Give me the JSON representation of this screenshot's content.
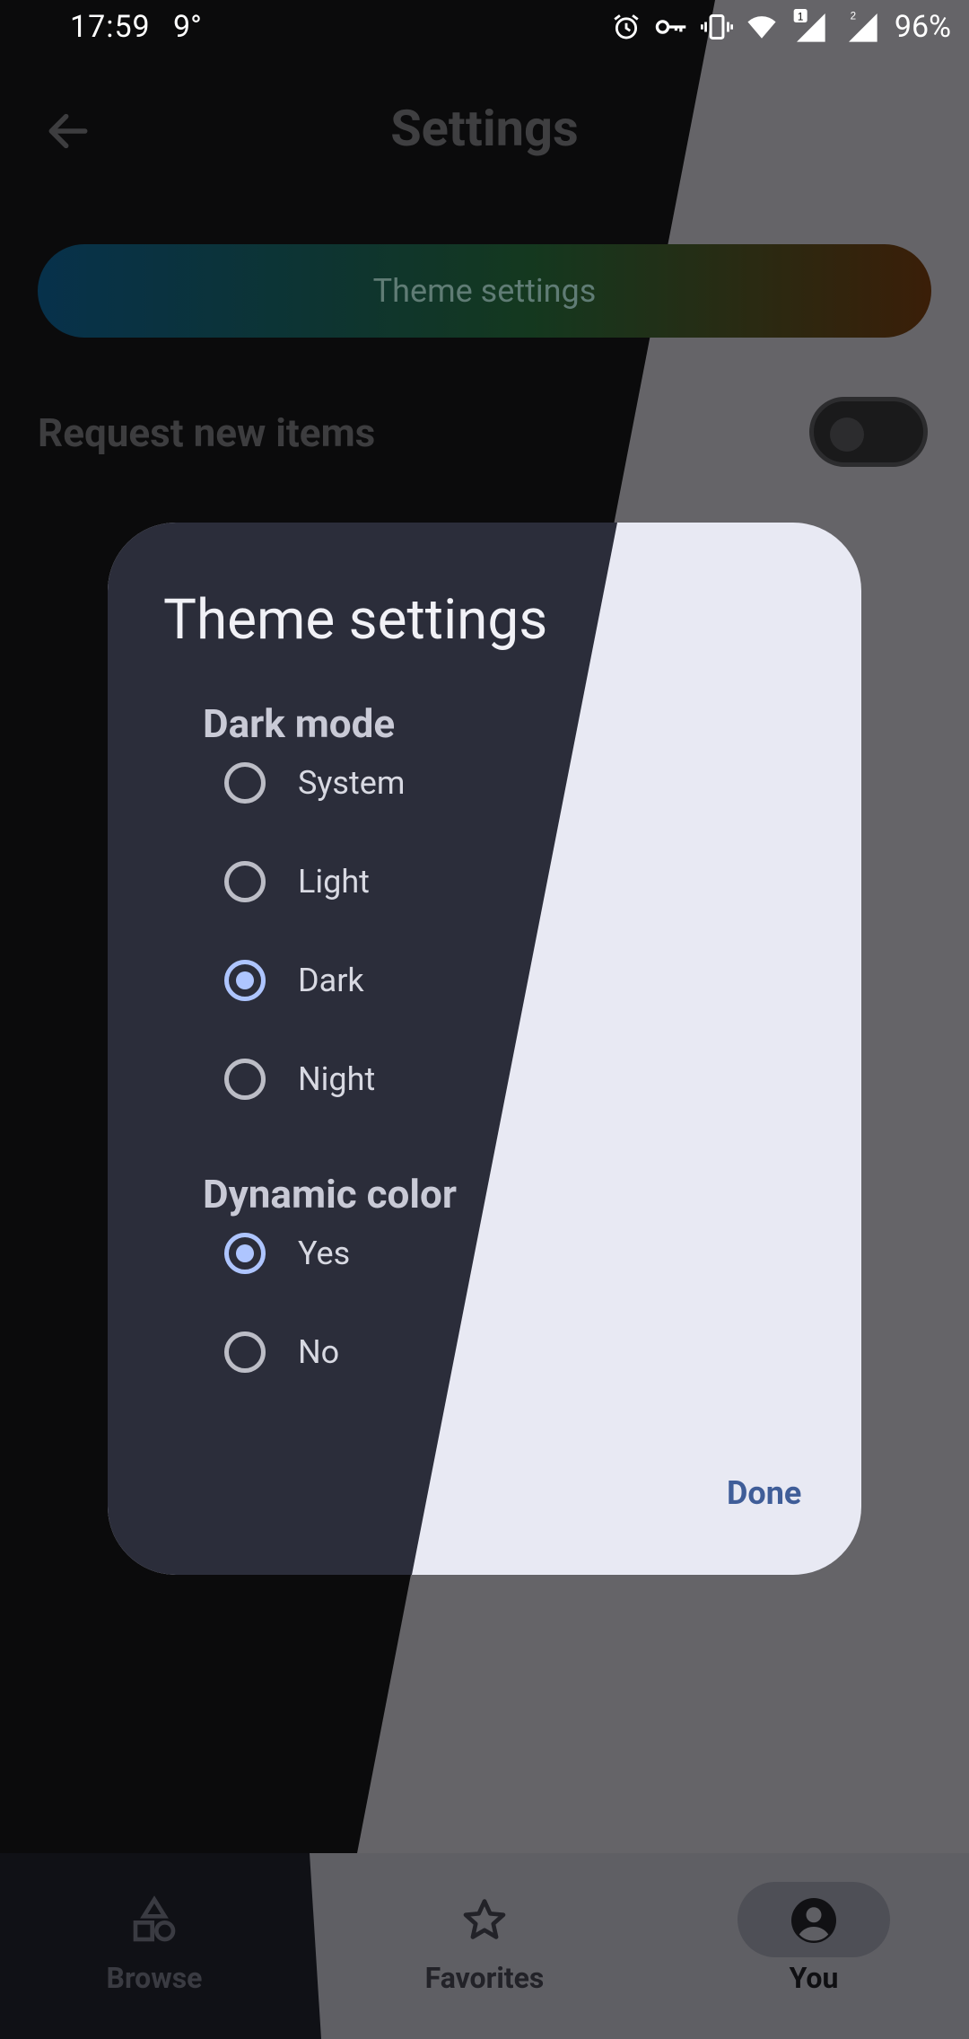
{
  "status_bar": {
    "time": "17:59",
    "temperature": "9°",
    "battery": "96%"
  },
  "app_bar": {
    "title": "Settings",
    "back_icon": "arrow-back-icon"
  },
  "theme_button": {
    "label": "Theme settings"
  },
  "request_new_items": {
    "label": "Request new items",
    "enabled": false
  },
  "dialog": {
    "title": "Theme settings",
    "dark_mode": {
      "heading": "Dark mode",
      "options": [
        {
          "label": "System",
          "selected": false
        },
        {
          "label": "Light",
          "selected": false
        },
        {
          "label": "Dark",
          "selected": true
        },
        {
          "label": "Night",
          "selected": false
        }
      ]
    },
    "dynamic_color": {
      "heading": "Dynamic color",
      "options": [
        {
          "label": "Yes",
          "selected": true
        },
        {
          "label": "No",
          "selected": false
        }
      ]
    },
    "done_label": "Done"
  },
  "bottom_nav": {
    "items": [
      {
        "label": "Browse",
        "icon": "shapes-icon",
        "active": false
      },
      {
        "label": "Favorites",
        "icon": "star-icon",
        "active": false
      },
      {
        "label": "You",
        "icon": "account-circle-icon",
        "active": true
      }
    ]
  },
  "colors": {
    "accent": "#aec5ff",
    "done": "#3f5d98",
    "dialog_dark": "#2b2d3a",
    "dialog_light": "#e8e9f3"
  }
}
